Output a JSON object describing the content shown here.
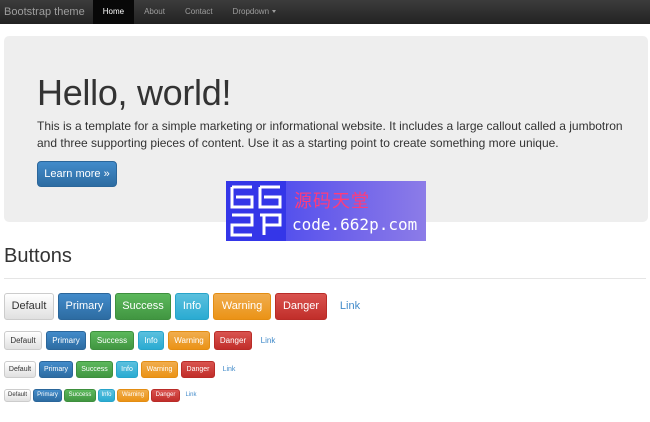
{
  "navbar": {
    "brand": "Bootstrap theme",
    "items": [
      {
        "label": "Home",
        "active": true
      },
      {
        "label": "About"
      },
      {
        "label": "Contact"
      },
      {
        "label": "Dropdown",
        "dropdown": true
      }
    ]
  },
  "jumbotron": {
    "title": "Hello, world!",
    "text": "This is a template for a simple marketing or informational website. It includes a large callout called a jumbotron and three supporting pieces of content. Use it as a starting point to create something more unique.",
    "button_label": "Learn more »"
  },
  "watermark": {
    "logo_text": "662P",
    "title": "源码天堂",
    "url": "code.662p.com"
  },
  "buttons_section": {
    "title": "Buttons",
    "labels": {
      "default": "Default",
      "primary": "Primary",
      "success": "Success",
      "info": "Info",
      "warning": "Warning",
      "danger": "Danger",
      "link": "Link"
    }
  },
  "colors": {
    "navbar": "#222222",
    "jumbotron_bg": "#eeeeee",
    "primary": "#428bca",
    "success": "#5cb85c",
    "info": "#5bc0de",
    "warning": "#f0ad4e",
    "danger": "#d9534f"
  }
}
